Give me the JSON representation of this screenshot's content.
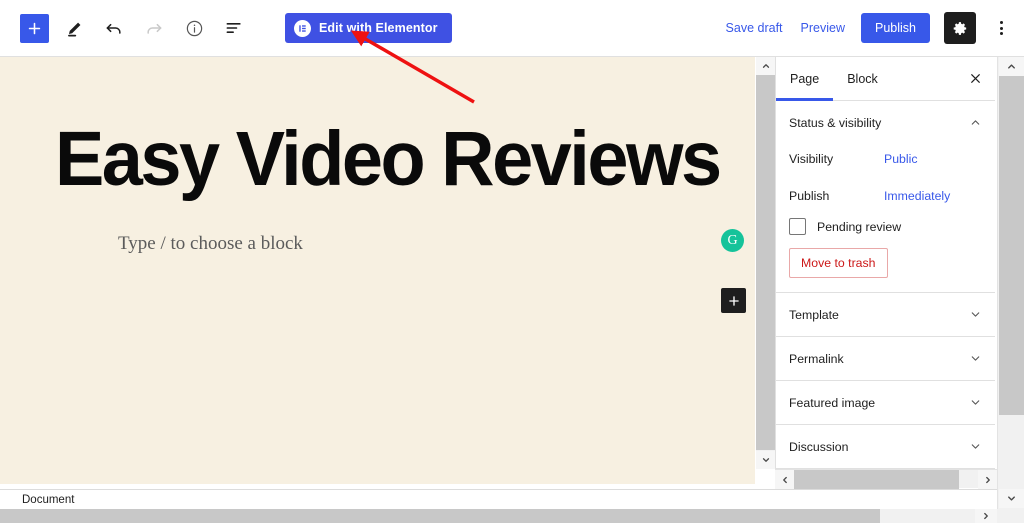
{
  "toolbar": {
    "add_block_label": "Add block",
    "tools": [
      {
        "name": "add-block-button",
        "label": "Add block"
      },
      {
        "name": "edit-tool-button",
        "label": "Tools"
      },
      {
        "name": "undo-button",
        "label": "Undo"
      },
      {
        "name": "redo-button",
        "label": "Redo"
      },
      {
        "name": "details-button",
        "label": "Details"
      },
      {
        "name": "list-view-button",
        "label": "List view"
      }
    ],
    "elementor_button": "Edit with Elementor",
    "elementor_icon_letter": "E",
    "save_draft": "Save draft",
    "preview": "Preview",
    "publish": "Publish",
    "settings_label": "Settings",
    "options_label": "Options",
    "accent_blue": "#3858e9",
    "elementor_blue": "#3f51e3"
  },
  "editor": {
    "post_title": "Easy Video Reviews",
    "block_placeholder": "Type / to choose a block",
    "grammarly_letter": "G",
    "grammarly_color": "#15c39a",
    "inserter_label": "+",
    "canvas_background": "#f7f0e1"
  },
  "annotation": {
    "color": "#ee1111",
    "name": "red-arrow-pointing-to-elementor-button"
  },
  "sidebar": {
    "tabs": [
      {
        "label": "Page",
        "active": true
      },
      {
        "label": "Block",
        "active": false
      }
    ],
    "close_label": "Close settings",
    "status_panel": {
      "title": "Status & visibility",
      "rows": [
        {
          "label": "Visibility",
          "value": "Public"
        },
        {
          "label": "Publish",
          "value": "Immediately"
        }
      ],
      "pending_review": "Pending review",
      "pending_review_checked": false,
      "move_to_trash": "Move to trash",
      "trash_color": "#cc1818"
    },
    "panels": [
      {
        "label": "Template"
      },
      {
        "label": "Permalink"
      },
      {
        "label": "Featured image"
      },
      {
        "label": "Discussion"
      }
    ]
  },
  "statusbar": {
    "label": "Document"
  }
}
